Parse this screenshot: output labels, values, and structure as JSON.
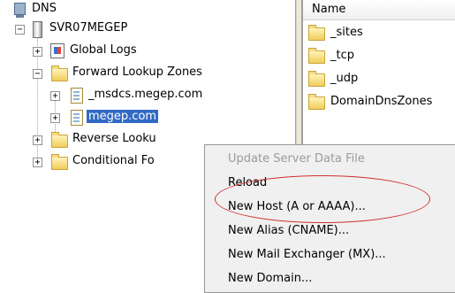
{
  "tree": {
    "root": "DNS",
    "server": "SVR07MEGEP",
    "global_logs": "Global Logs",
    "forward_zones": "Forward Lookup Zones",
    "zone1": "_msdcs.megep.com",
    "zone2": "megep.com",
    "reverse_zones": "Reverse Looku",
    "conditional": "Conditional Fo",
    "expand_glyph": "+",
    "collapse_glyph": "−"
  },
  "list": {
    "column_name": "Name",
    "items": [
      "_sites",
      "_tcp",
      "_udp",
      "DomainDnsZones"
    ]
  },
  "context_menu": {
    "items": [
      {
        "label": "Update Server Data File",
        "enabled": false
      },
      {
        "label": "Reload",
        "enabled": true
      },
      {
        "label": "New Host (A or AAAA)...",
        "enabled": true,
        "highlighted_oval": true
      },
      {
        "label": "New Alias (CNAME)...",
        "enabled": true
      },
      {
        "label": "New Mail Exchanger (MX)...",
        "enabled": true
      },
      {
        "label": "New Domain...",
        "enabled": true
      }
    ]
  },
  "colors": {
    "selection": "#316ac5",
    "oval": "#d12f2f",
    "menu_bg": "#f0f0f0"
  }
}
